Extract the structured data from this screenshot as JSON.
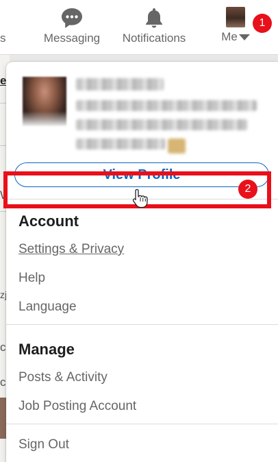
{
  "nav": {
    "cut_label": "s",
    "messaging_label": "Messaging",
    "notifications_label": "Notifications",
    "me_label": "Me",
    "badge_1": "1"
  },
  "background": {
    "fragments": [
      "e",
      "W",
      "zj",
      "c",
      "c"
    ]
  },
  "dropdown": {
    "view_profile_label": "View Profile",
    "account_title": "Account",
    "settings_label": "Settings & Privacy",
    "badge_2": "2",
    "help_label": "Help",
    "language_label": "Language",
    "manage_title": "Manage",
    "posts_label": "Posts & Activity",
    "job_posting_label": "Job Posting Account",
    "sign_out_label": "Sign Out"
  },
  "colors": {
    "accent": "#0a66c2",
    "highlight": "#e8101a",
    "muted_text": "#666666"
  },
  "icons": {
    "messaging": "messaging-icon",
    "notifications": "bell-icon",
    "me_caret": "caret-down-icon",
    "cursor": "hand-pointer-icon"
  }
}
